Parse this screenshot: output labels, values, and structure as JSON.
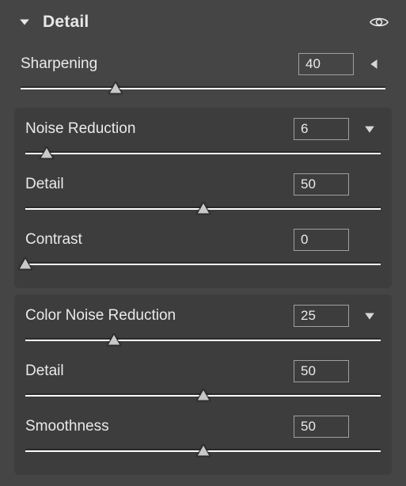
{
  "panel": {
    "title": "Detail"
  },
  "sharpening": {
    "label": "Sharpening",
    "value": "40",
    "pos": 26
  },
  "noise": {
    "label": "Noise Reduction",
    "value": "6",
    "pos": 6,
    "detail": {
      "label": "Detail",
      "value": "50",
      "pos": 50
    },
    "contrast": {
      "label": "Contrast",
      "value": "0",
      "pos": 0
    }
  },
  "colorNoise": {
    "label": "Color Noise Reduction",
    "value": "25",
    "pos": 25,
    "detail": {
      "label": "Detail",
      "value": "50",
      "pos": 50
    },
    "smoothness": {
      "label": "Smoothness",
      "value": "50",
      "pos": 50
    }
  }
}
